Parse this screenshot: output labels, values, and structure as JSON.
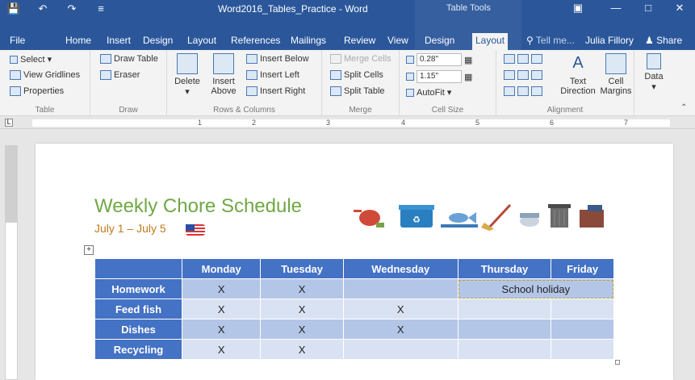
{
  "titlebar": {
    "title": "Word2016_Tables_Practice - Word",
    "contextual_label": "Table Tools"
  },
  "tabs": [
    "File",
    "Home",
    "Insert",
    "Design",
    "Layout",
    "References",
    "Mailings",
    "Review",
    "View",
    "Design",
    "Layout"
  ],
  "tell_me": "Tell me...",
  "user_name": "Julia Fillory",
  "share_label": "Share",
  "ribbon": {
    "table_group": {
      "select": "Select",
      "gridlines": "View Gridlines",
      "properties": "Properties",
      "label": "Table"
    },
    "draw_group": {
      "draw_table": "Draw Table",
      "eraser": "Eraser",
      "label": "Draw"
    },
    "rows_group": {
      "delete": "Delete",
      "insert_above_1": "Insert",
      "insert_above_2": "Above",
      "insert_below": "Insert Below",
      "insert_left": "Insert Left",
      "insert_right": "Insert Right",
      "label": "Rows & Columns"
    },
    "merge_group": {
      "merge_cells": "Merge Cells",
      "split_cells": "Split Cells",
      "split_table": "Split Table",
      "label": "Merge"
    },
    "cellsize_group": {
      "height": "0.28\"",
      "width": "1.15\"",
      "autofit": "AutoFit",
      "label": "Cell Size"
    },
    "alignment_group": {
      "text_direction_1": "Text",
      "text_direction_2": "Direction",
      "cell_margins_1": "Cell",
      "cell_margins_2": "Margins",
      "label": "Alignment"
    },
    "data_group": {
      "data": "Data"
    }
  },
  "ruler_numbers": [
    "1",
    "2",
    "3",
    "4",
    "5",
    "6",
    "7"
  ],
  "document": {
    "heading": "Weekly Chore Schedule",
    "subheading": "July 1 – July 5",
    "table": {
      "headers": [
        "",
        "Monday",
        "Tuesday",
        "Wednesday",
        "Thursday",
        "Friday"
      ],
      "rows": [
        {
          "label": "Homework",
          "cells": [
            "X",
            "X",
            ""
          ],
          "merged": "School holiday"
        },
        {
          "label": "Feed fish",
          "cells": [
            "X",
            "X",
            "X",
            "",
            ""
          ]
        },
        {
          "label": "Dishes",
          "cells": [
            "X",
            "X",
            "X",
            "",
            ""
          ]
        },
        {
          "label": "Recycling",
          "cells": [
            "X",
            "X",
            "",
            "",
            ""
          ]
        }
      ]
    }
  },
  "colors": {
    "word_blue": "#2b579a",
    "table_header": "#4472c4",
    "band_dark": "#b4c6e7",
    "band_light": "#d9e2f3",
    "heading_green": "#70a845"
  }
}
